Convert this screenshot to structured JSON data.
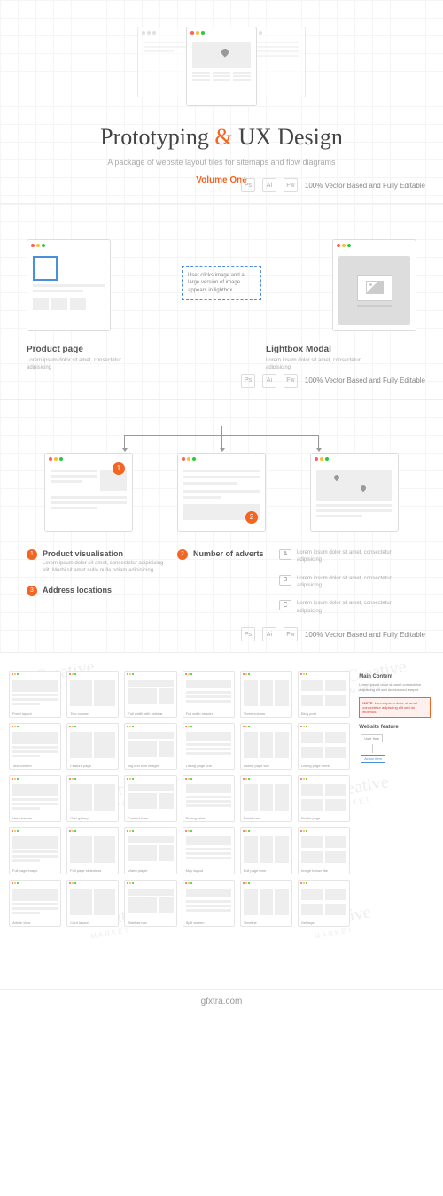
{
  "hero": {
    "title_a": "Prototyping",
    "title_amp": "&",
    "title_b": "UX Design",
    "subtitle": "A package of website layout tiles for sitemaps and flow diagrams",
    "volume": "Volume One"
  },
  "badges": {
    "ps": "Ps",
    "ai": "Ai",
    "fw": "Fw",
    "text": "100% Vector Based and Fully Editable"
  },
  "section2": {
    "note": "User clicks image and a large version of image appears in lightbox",
    "left_title": "Product page",
    "left_desc": "Lorem ipsum dolor sit amet, consectetur adipisicing",
    "right_title": "Lightbox Modal",
    "right_desc": "Lorem ipsum dolor sit amet, consectetur adipisicing"
  },
  "section3": {
    "badges": {
      "b1": "1",
      "b2": "2",
      "b3": "3"
    },
    "items": [
      {
        "num": "1",
        "title": "Product visualisation",
        "desc": "Lorem ipsum dolor sit amet, consectetur adipisicing elit. Morbi sit amet nulla nulla odiam adipisicing."
      },
      {
        "num": "3",
        "title": "Address locations",
        "desc": ""
      },
      {
        "num": "2",
        "title": "Number of adverts",
        "desc": ""
      }
    ],
    "letters": [
      {
        "l": "A",
        "desc": "Lorem ipsum dolor sit amet, consectetur adipisicing"
      },
      {
        "l": "B",
        "desc": "Lorem ipsum dolor sit amet, consectetur adipisicing"
      },
      {
        "l": "C",
        "desc": "Lorem ipsum dolor sit amet, consectetur adipisicing"
      }
    ]
  },
  "section4": {
    "watermark": "Creative",
    "watermark_sub": "MARKET",
    "side": {
      "main_title": "Main Content",
      "main_text": "Lorem ipsum dolor sit amet consectetur adipiscing elit sed do eiusmod tempor.",
      "note_label": "NOTE:",
      "note_text": "Lorem ipsum dolor sit amet consectetur adipiscing elit sed do eiusmod.",
      "feature_title": "Website feature",
      "conn1": "User flow",
      "conn2": "Action item"
    },
    "tiles": [
      "Fixed layout",
      "Two column",
      "Full width with sidebar",
      "Full width header",
      "Three column",
      "Blog post",
      "Text content",
      "Feature page",
      "Big text with images",
      "Listing page one",
      "Listing page two",
      "Listing page three",
      "Hero banner",
      "Grid gallery",
      "Contact form",
      "Pricing table",
      "Dashboard",
      "Profile page",
      "Full page image",
      "Full page slideshow",
      "Video player",
      "Map layout",
      "Full page form",
      "Image below title",
      "Article view",
      "Card layout",
      "Sidebar nav",
      "Split screen",
      "Timeline",
      "Settings"
    ]
  },
  "footer": {
    "url": "gfxtra.com"
  }
}
